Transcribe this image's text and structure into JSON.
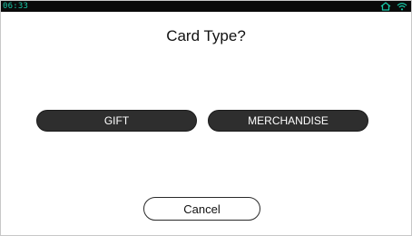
{
  "status_bar": {
    "time": "06:33",
    "icons": [
      "home-icon",
      "wifi-icon"
    ],
    "accent_color": "#18c7a6",
    "background_color": "#0a0a0a"
  },
  "dialog": {
    "title": "Card Type?",
    "options": [
      {
        "label": "GIFT"
      },
      {
        "label": "MERCHANDISE"
      }
    ],
    "cancel_label": "Cancel"
  }
}
